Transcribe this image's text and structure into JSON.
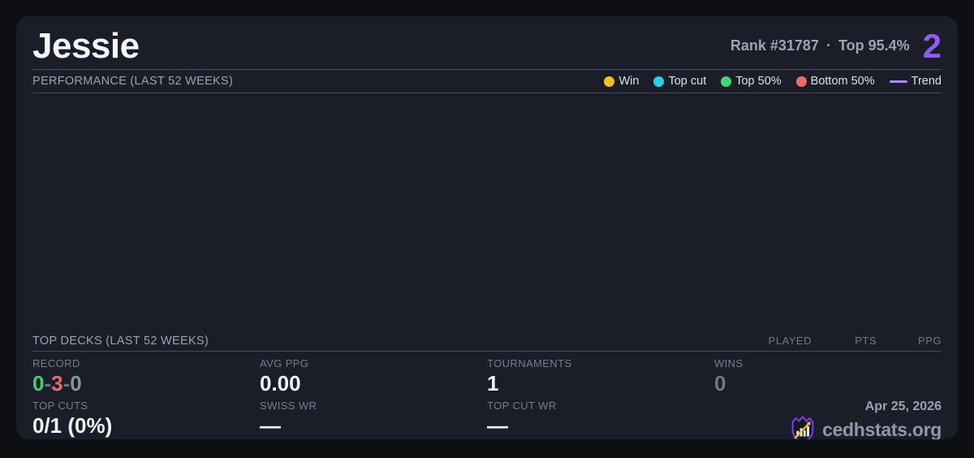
{
  "colors": {
    "page_bg": "#0e0f13",
    "card_bg": "#1b1e28",
    "accent_purple": "#8b5cf6",
    "trend_purple": "#a78bfa",
    "win_gold": "#f2c21f",
    "topcut_cyan": "#2ad0e8",
    "top50_green": "#3fd67c",
    "bottom50_red": "#ef6a6a",
    "record_win_green": "#3ecf77",
    "record_loss_red": "#ef6a6a"
  },
  "header": {
    "title": "Jessie",
    "rank": "Rank #31787",
    "separator": "·",
    "percentile": "Top 95.4%",
    "count": "2"
  },
  "performance": {
    "title": "PERFORMANCE (LAST 52 WEEKS)",
    "legend": [
      {
        "label": "Win",
        "color": "#f2c21f",
        "type": "dot"
      },
      {
        "label": "Top cut",
        "color": "#2ad0e8",
        "type": "dot"
      },
      {
        "label": "Top 50%",
        "color": "#3fd67c",
        "type": "dot"
      },
      {
        "label": "Bottom 50%",
        "color": "#ef6a6a",
        "type": "dot"
      },
      {
        "label": "Trend",
        "color": "#a78bfa",
        "type": "line"
      }
    ]
  },
  "chart_data": {
    "type": "scatter",
    "title": "PERFORMANCE (LAST 52 WEEKS)",
    "series": [],
    "note": "empty chart area - no data points plotted"
  },
  "top_decks": {
    "title": "TOP DECKS (LAST 52 WEEKS)",
    "columns": [
      "PLAYED",
      "PTS",
      "PPG"
    ],
    "rows": []
  },
  "stats": {
    "record": {
      "label": "RECORD",
      "wins": "0",
      "losses": "3",
      "draws": "0",
      "sep": "-"
    },
    "avg_ppg": {
      "label": "AVG PPG",
      "value": "0.00"
    },
    "tournaments": {
      "label": "TOURNAMENTS",
      "value": "1"
    },
    "wins": {
      "label": "WINS",
      "value": "0"
    },
    "top_cuts": {
      "label": "TOP CUTS",
      "value": "0/1 (0%)"
    },
    "swiss_wr": {
      "label": "SWISS WR",
      "value": "—"
    },
    "top_cut_wr": {
      "label": "TOP CUT WR",
      "value": "—"
    }
  },
  "footer": {
    "date": "Apr 25, 2026",
    "site": "cedhstats.org"
  }
}
